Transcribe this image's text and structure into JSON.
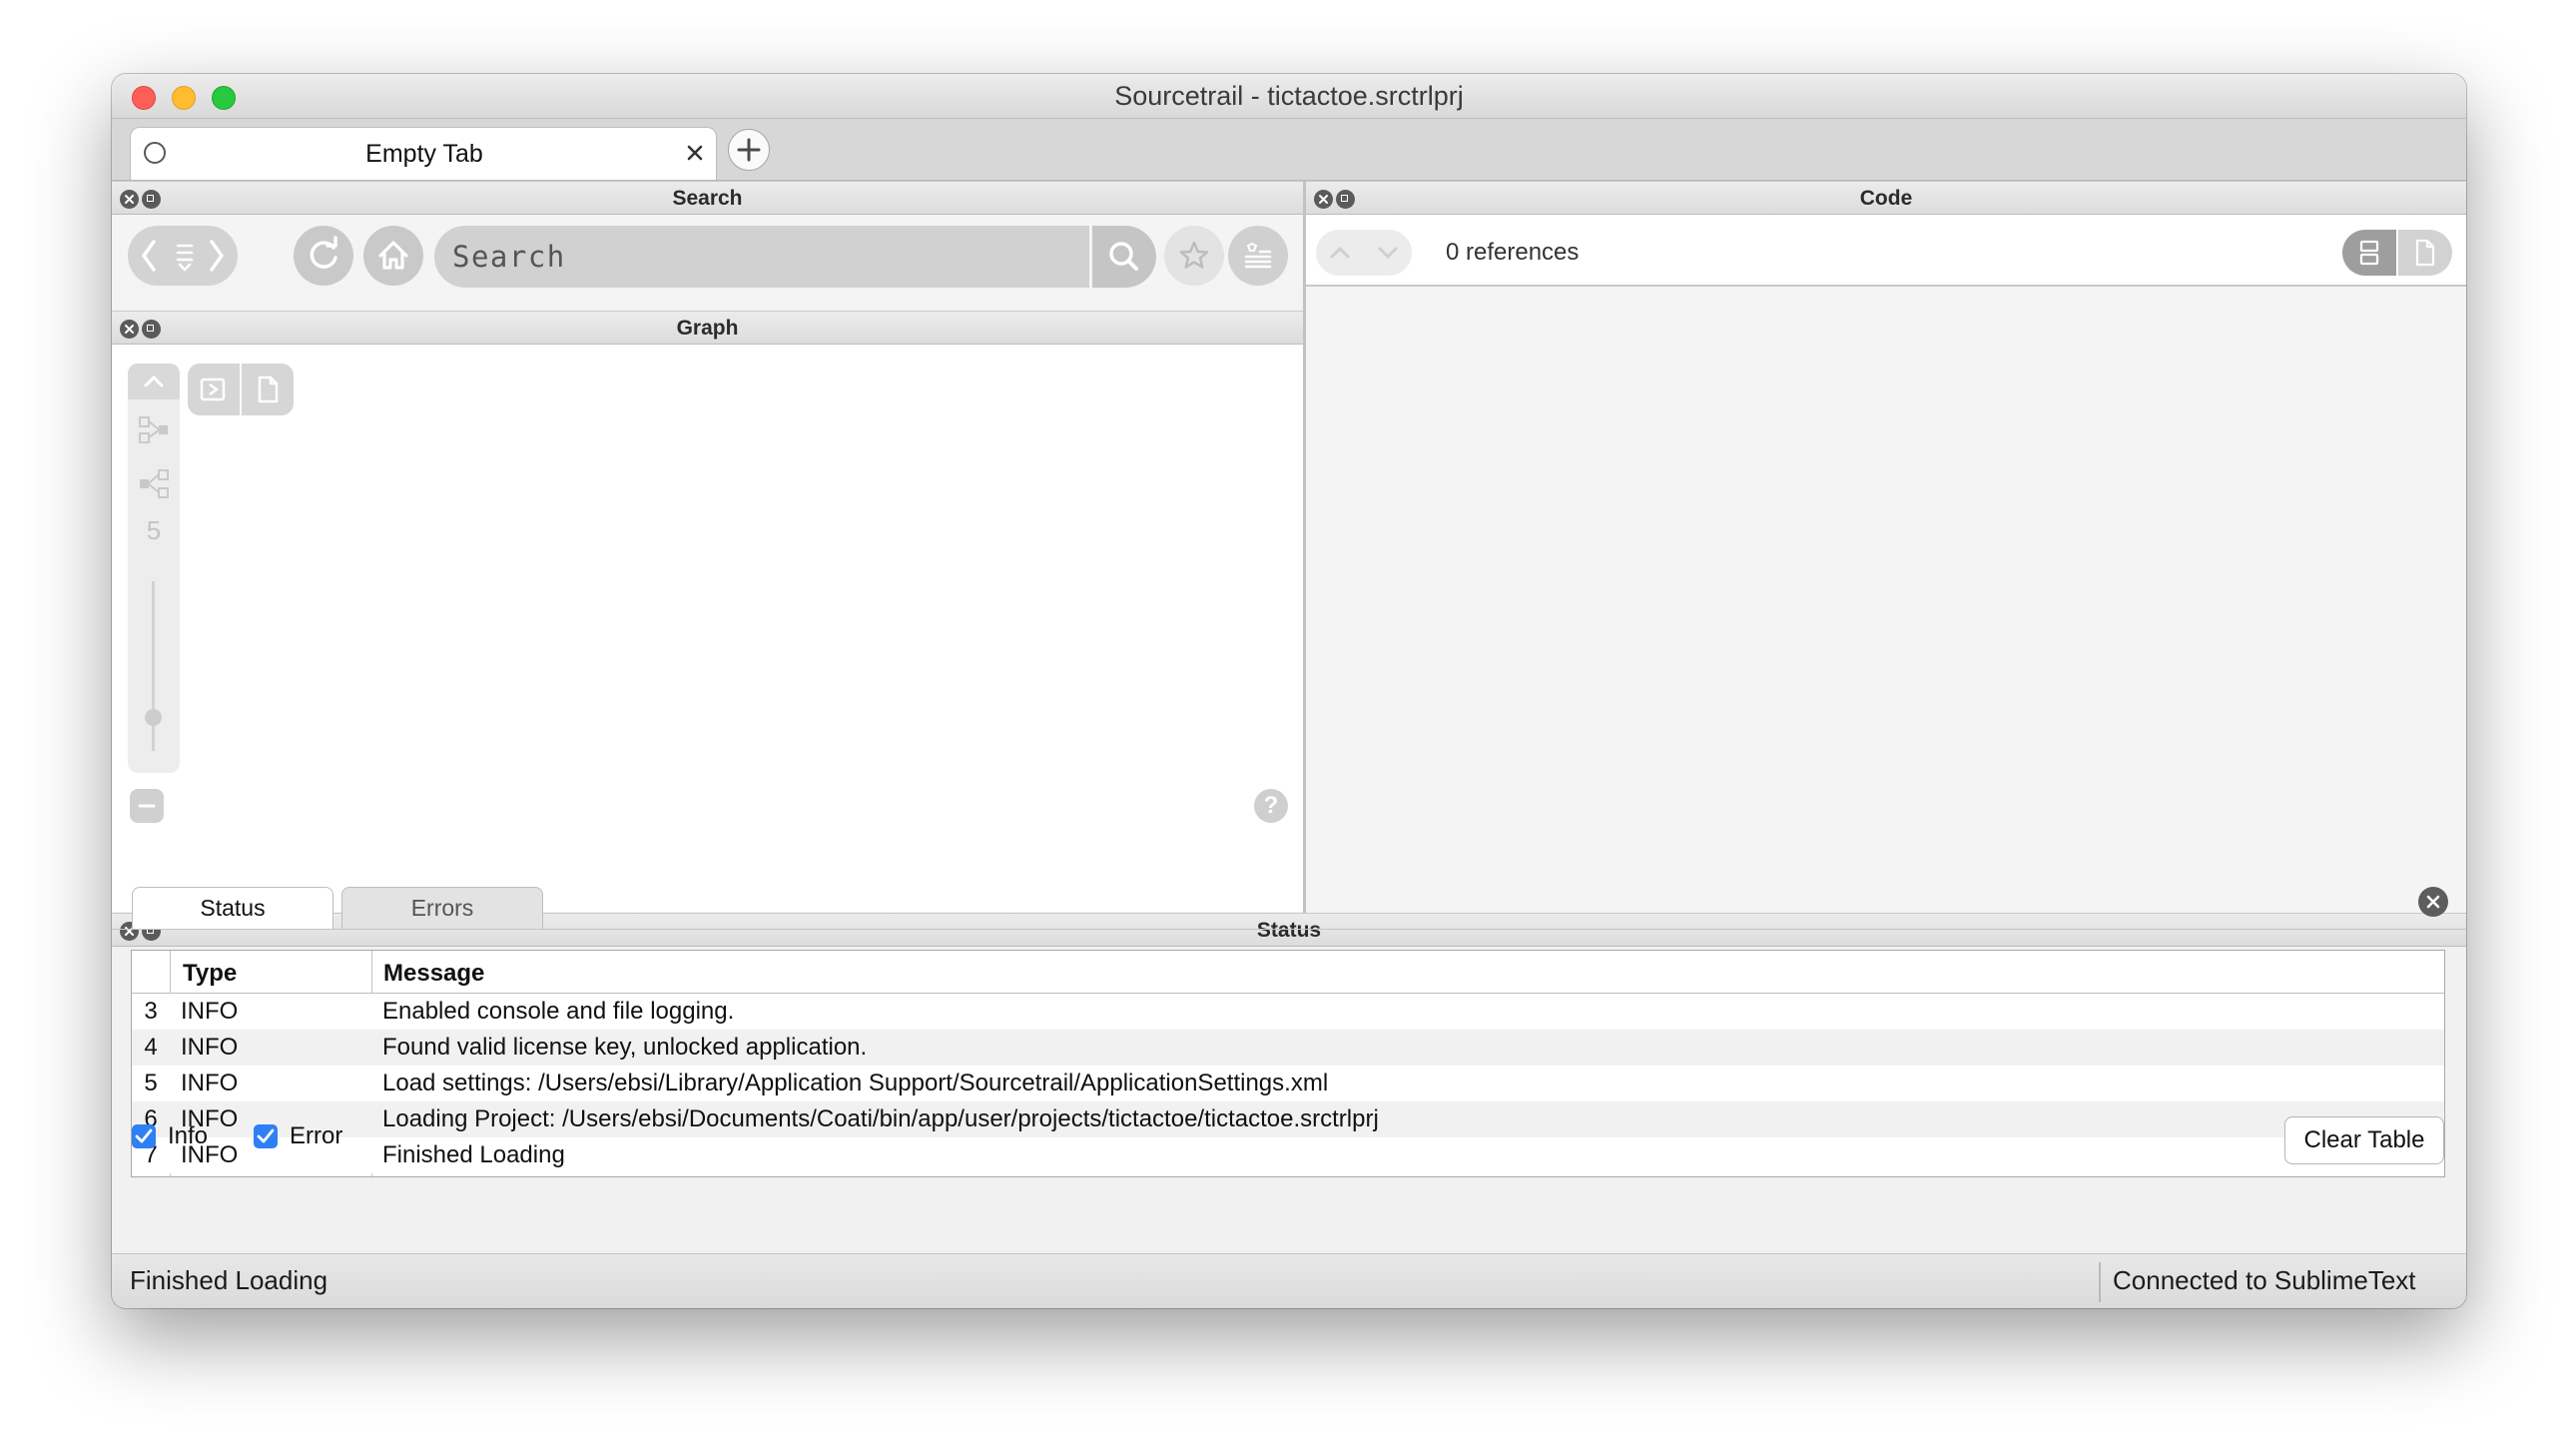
{
  "window": {
    "title": "Sourcetrail - tictactoe.srctrlprj"
  },
  "tabs": [
    {
      "label": "Empty Tab"
    }
  ],
  "panels": {
    "search": "Search",
    "code": "Code",
    "graph": "Graph",
    "status": "Status"
  },
  "search": {
    "placeholder": "Search"
  },
  "code": {
    "references": "0 references"
  },
  "graph": {
    "depth": "5",
    "help": "?"
  },
  "status": {
    "tabs": [
      "Status",
      "Errors"
    ],
    "columns": [
      "Type",
      "Message"
    ],
    "rows": [
      {
        "num": "3",
        "type": "INFO",
        "message": "Enabled console and file logging."
      },
      {
        "num": "4",
        "type": "INFO",
        "message": "Found valid license key, unlocked application."
      },
      {
        "num": "5",
        "type": "INFO",
        "message": "Load settings: /Users/ebsi/Library/Application Support/Sourcetrail/ApplicationSettings.xml"
      },
      {
        "num": "6",
        "type": "INFO",
        "message": "Loading Project: /Users/ebsi/Documents/Coati/bin/app/user/projects/tictactoe/tictactoe.srctrlprj"
      },
      {
        "num": "7",
        "type": "INFO",
        "message": "Finished Loading"
      }
    ],
    "filters": [
      {
        "label": "Info",
        "checked": true
      },
      {
        "label": "Error",
        "checked": true
      }
    ],
    "clear_label": "Clear Table"
  },
  "statusbar": {
    "left": "Finished Loading",
    "right": "Connected to SublimeText"
  },
  "colors": {
    "close": "#ff5f57",
    "minimize": "#febc2e",
    "zoom": "#28c840",
    "checkbox": "#2f7ff5"
  }
}
